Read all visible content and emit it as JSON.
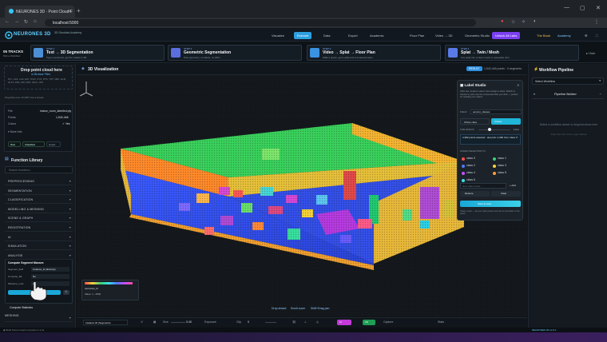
{
  "browser": {
    "tab_title": "NEURONES 3D · Point Cloud F",
    "url": "localhost:5000"
  },
  "app": {
    "brand": "NEURONES 3D",
    "brand_sub": "3D Geodata Academy",
    "nav": [
      "Visualize",
      "Execute",
      "Data",
      "Export",
      "Academic",
      "Floor Plan",
      "Video → 3D",
      "Geometric Studio"
    ],
    "nav_active": "Execute",
    "cta": "Unlock All Labs",
    "book": "The Book",
    "academy": "Academy"
  },
  "tracks": {
    "title": "05 TRACKS",
    "sub": "Pick a Workflow"
  },
  "steps": [
    {
      "id": "STEP 1",
      "title": "Text → 3D Segmentation",
      "desc": "Type a sentence, get the masks in 3D."
    },
    {
      "id": "STEP 2",
      "title": "Geometric Segmentation",
      "desc": "Pure geometry, no labels, no GPU."
    },
    {
      "id": "STEP 3",
      "title": "Video → Splat → Floor Plan",
      "desc": "Walk a space, get a splat and a measured plan."
    },
    {
      "id": "STEP 4",
      "title": "Splat → Twin / Mesh",
      "desc": "Any splat into a clean mesh or queryable twin."
    }
  ],
  "hide_label": "Hide",
  "left": {
    "drop_title": "Drop point cloud here",
    "drop_sub": "or Browse Files",
    "formats": "PLY, LAS, LAZ, E57, PCD, XYZ, PTS, TXT, OBJ, GLB, GLTF, FBX, ZIP, MP4, MOV, JPG",
    "fine": "Drag files over 10 GB? Use a stream",
    "file_label": "File",
    "file_value": "indoor_room_labelled.ply",
    "points_label": "Points",
    "points_value": "1,542,446",
    "colors_label": "Colors",
    "colors_value": "✓ Yes",
    "more_info": "More Info",
    "modes": [
      "Raw",
      "Classified",
      "Graph"
    ],
    "fl_title": "Function Library",
    "fl_search": "Search functions...",
    "categories": [
      "PREPROCESSING",
      "SEGMENTATION",
      "CLASSIFICATION",
      "MODELLING & MESHING",
      "SCENE & GRAPH",
      "REGISTRATION",
      "AI",
      "SIMULATION",
      "ANALYSIS"
    ],
    "card_title": "Compute Segment Masses",
    "card_rows": [
      [
        "Segment_field",
        "instance_id (discrete)"
      ],
      [
        "Compute_ML",
        "No"
      ],
      [
        "Measure_Loss",
        "No"
      ]
    ],
    "compute_stats": "Compute Statistics",
    "meshing": "MESHING"
  },
  "viewport": {
    "title": "3D Visualization",
    "badge": "RESULT",
    "info": "1,542,446 points · 0 segments",
    "hint_drop": "Drop ahead",
    "hint_scroll": "Scroll zoom",
    "hint_shift": "Shift+Drag pan",
    "legend_name": "neurones_id",
    "legend_val": "Value: 1 - 2500"
  },
  "studio": {
    "title": "Label Studio",
    "desc": "Click two model to select, then assign a class. Switch to Cluster to pick only the connected blob you click — perfect for isolating one object.",
    "field_label": "FIELD",
    "field_value": "semcur_classes",
    "mode_a": "Whole class",
    "mode_b": "Cluster",
    "size_label": "LINE RADIUS",
    "size_value": "1.0 m",
    "selected": "2,382 points selected · last pick: 2,382 from 'class 3'",
    "assign_label": "ASSIGN SELECTION TO",
    "classes": [
      "class 0",
      "class 1",
      "class 2",
      "class 3",
      "class 4",
      "class 5",
      "class 6"
    ],
    "class_colors": [
      "#ff4d4d",
      "#3ad17a",
      "#4f7bff",
      "#ffd23a",
      "#c94dff",
      "#ff9c3a",
      "#3ae0e6"
    ],
    "new_class": "New class name...",
    "add": "+ Add",
    "restore": "Restore",
    "clear": "Clear",
    "save": "Save & reset",
    "footer": "Chaos mode — all your picks persist and can be tried later in this panel."
  },
  "workflow": {
    "title": "Workflow Pipeline",
    "select": "Select Workflow",
    "builder": "Pipeline Builder",
    "empty": "Select a workflow above or drag functions here",
    "empty_sub": "Drop from left menu to get started"
  },
  "toolbar": {
    "select": "Instance ID (Segments)",
    "size_label": "Size",
    "size_value": "0.40",
    "exposure": "Exposure",
    "clip": "Clip",
    "clip_value": "0",
    "ai": "AI",
    "fill": "Fill",
    "capture": "Capture",
    "stats": "Stats"
  },
  "status": {
    "left": "◉ Build Scene Graph complete in 2.4s",
    "right": "NEURONES 3D  v2.4.1"
  }
}
